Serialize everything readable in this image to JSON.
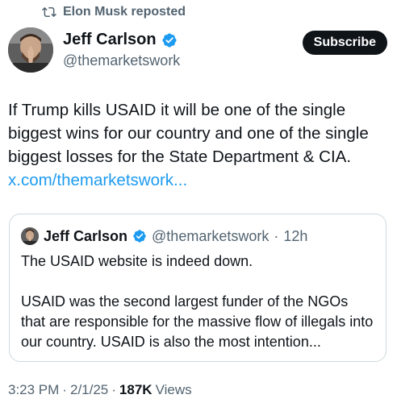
{
  "repost": {
    "label": "Elon Musk reposted",
    "icon": "repost-icon"
  },
  "author": {
    "name": "Jeff Carlson",
    "handle": "@themarketswork",
    "verified_color": "#1d9bf0",
    "avatar": "avatar-praying-hands"
  },
  "subscribe_label": "Subscribe",
  "tweet": {
    "text": "If Trump kills USAID it will be one of the single biggest wins for our country and one of the single biggest losses for the State Department & CIA.",
    "link": "x.com/themarketswork..."
  },
  "quote": {
    "name": "Jeff Carlson",
    "handle": "@themarketswork",
    "separator": "·",
    "time": "12h",
    "paragraph1": "The USAID website is indeed down.",
    "paragraph2": "USAID was the second largest funder of the NGOs that are responsible for the massive flow of illegals into our country. USAID is also the most intention..."
  },
  "meta": {
    "time": "3:23 PM",
    "sep1": "·",
    "date": "2/1/25",
    "sep2": "·",
    "views_count": "187K",
    "views_label": "Views"
  },
  "colors": {
    "text": "#0f1419",
    "secondary": "#536471",
    "link": "#1d9bf0",
    "border": "#cfd9de"
  }
}
